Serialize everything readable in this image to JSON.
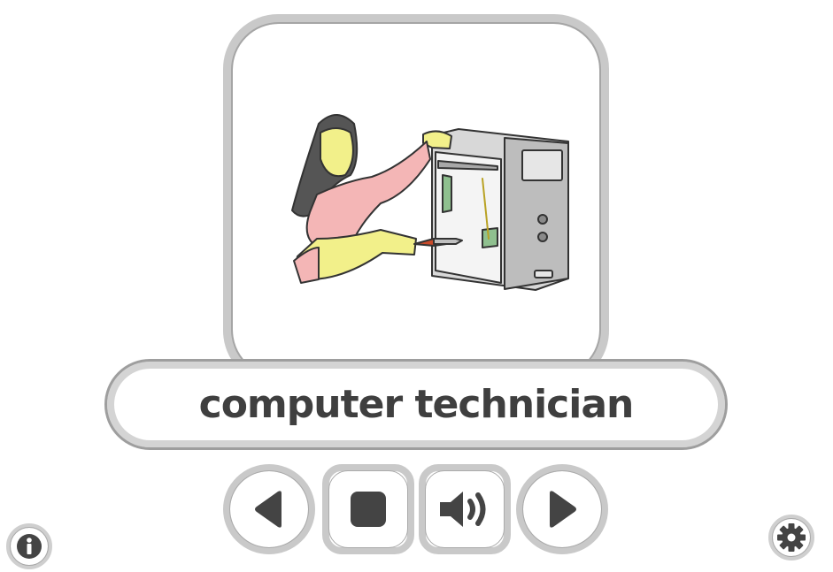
{
  "card": {
    "image_subject": "computer technician",
    "caption": "computer technician"
  },
  "controls": {
    "previous_icon": "triangle-left-icon",
    "stop_icon": "stop-square-icon",
    "speak_icon": "speaker-icon",
    "next_icon": "triangle-right-icon"
  },
  "corner": {
    "info_icon": "info-icon",
    "settings_icon": "gear-icon"
  },
  "colors": {
    "frame": "#c9c9c9",
    "icon": "#444444",
    "text": "#3f3f3f"
  }
}
